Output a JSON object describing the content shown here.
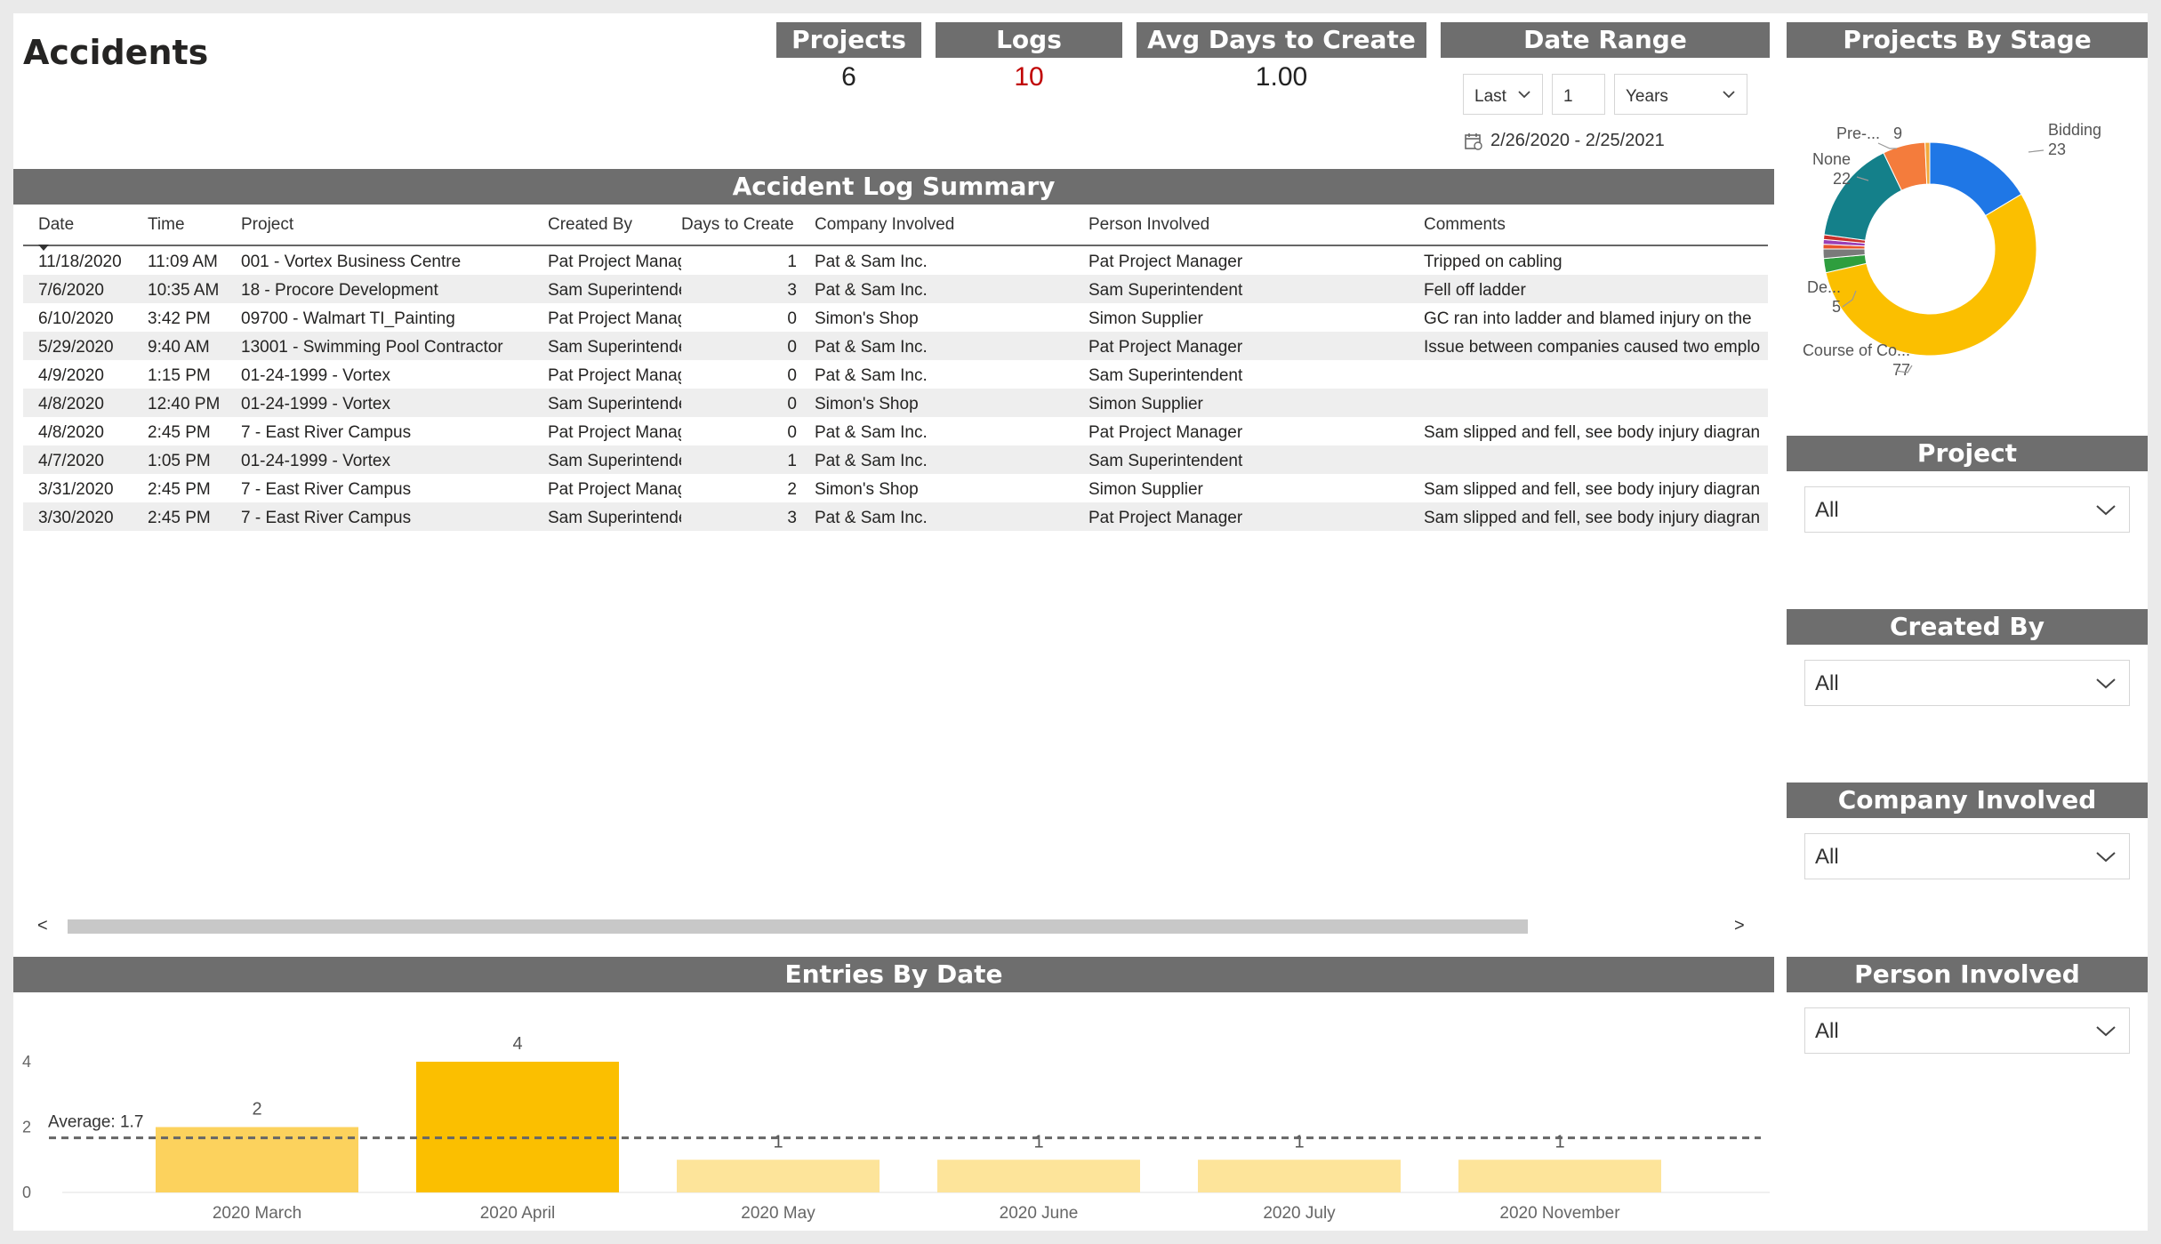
{
  "page": {
    "title": "Accidents"
  },
  "kpis": [
    {
      "label": "Projects",
      "value": "6"
    },
    {
      "label": "Logs",
      "value": "10"
    },
    {
      "label": "Avg Days to Create",
      "value": "1.00"
    }
  ],
  "colors": {
    "header_bg": "#6e6e6e",
    "logs_value": "#c00000",
    "bar_highlight": "#fbbf00",
    "bar_light": "#fcd25d",
    "bar_faded": "#fde49a"
  },
  "date_range": {
    "title": "Date Range",
    "mode": "Last",
    "count": "1",
    "unit": "Years",
    "range_text": "2/26/2020 - 2/25/2021"
  },
  "table": {
    "title": "Accident Log Summary",
    "columns": [
      "Date",
      "Time",
      "Project",
      "Created By",
      "Days to Create",
      "Company Involved",
      "Person Involved",
      "Comments"
    ],
    "rows": [
      [
        "11/18/2020",
        "11:09 AM",
        "001 - Vortex Business Centre",
        "Pat Project Manager",
        "1",
        "Pat & Sam Inc.",
        "Pat Project Manager",
        "Tripped on cabling"
      ],
      [
        "7/6/2020",
        "10:35 AM",
        "18 - Procore Development",
        "Sam Superintendent",
        "3",
        "Pat & Sam Inc.",
        "Sam Superintendent",
        "Fell off ladder"
      ],
      [
        "6/10/2020",
        "3:42 PM",
        "09700 - Walmart TI_Painting",
        "Pat Project Manager",
        "0",
        "Simon's Shop",
        "Simon Supplier",
        "GC ran into ladder and blamed injury on the"
      ],
      [
        "5/29/2020",
        "9:40 AM",
        "13001 - Swimming Pool Contractor",
        "Sam Superintendent",
        "0",
        "Pat & Sam Inc.",
        "Pat Project Manager",
        "Issue between companies caused two emplo"
      ],
      [
        "4/9/2020",
        "1:15 PM",
        "01-24-1999 - Vortex",
        "Pat Project Manager",
        "0",
        "Pat & Sam Inc.",
        "Sam Superintendent",
        ""
      ],
      [
        "4/8/2020",
        "12:40 PM",
        "01-24-1999 - Vortex",
        "Sam Superintendent",
        "0",
        "Simon's Shop",
        "Simon Supplier",
        ""
      ],
      [
        "4/8/2020",
        "2:45 PM",
        "7 - East River Campus",
        "Pat Project Manager",
        "0",
        "Pat & Sam Inc.",
        "Pat Project Manager",
        "Sam slipped and fell, see body injury diagran"
      ],
      [
        "4/7/2020",
        "1:05 PM",
        "01-24-1999 - Vortex",
        "Sam Superintendent",
        "1",
        "Pat & Sam Inc.",
        "Sam Superintendent",
        ""
      ],
      [
        "3/31/2020",
        "2:45 PM",
        "7 - East River Campus",
        "Pat Project Manager",
        "2",
        "Simon's Shop",
        "Simon Supplier",
        "Sam slipped and fell, see body injury diagran"
      ],
      [
        "3/30/2020",
        "2:45 PM",
        "7 - East River Campus",
        "Sam Superintendent",
        "3",
        "Pat & Sam Inc.",
        "Pat Project Manager",
        "Sam slipped and fell, see body injury diagran"
      ]
    ],
    "scroll_left": "<",
    "scroll_right": ">"
  },
  "donut": {
    "title": "Projects By Stage",
    "labels": [
      {
        "name": "Bidding",
        "value": "23"
      },
      {
        "name": "Pre-...",
        "value": "9"
      },
      {
        "name": "None",
        "value": "22"
      },
      {
        "name": "De...",
        "value": "5"
      },
      {
        "name": "Course of Co...",
        "value": "77"
      }
    ]
  },
  "slicers": [
    {
      "title": "Project",
      "value": "All"
    },
    {
      "title": "Created By",
      "value": "All"
    },
    {
      "title": "Company Involved",
      "value": "All"
    },
    {
      "title": "Person Involved",
      "value": "All"
    }
  ],
  "chart_data": [
    {
      "type": "pie",
      "title": "Projects By Stage",
      "slices": [
        {
          "name": "Bidding",
          "value": 23,
          "color": "#1f77e6"
        },
        {
          "name": "Course of Co...",
          "value": 77,
          "color": "#fbbf00"
        },
        {
          "name": "",
          "value": 3,
          "color": "#2e9e3e"
        },
        {
          "name": "",
          "value": 2,
          "color": "#7a7a7a"
        },
        {
          "name": "",
          "value": 1,
          "color": "#e8542b"
        },
        {
          "name": "",
          "value": 1,
          "color": "#9b3fb5"
        },
        {
          "name": "",
          "value": 1,
          "color": "#c9302c"
        },
        {
          "name": "None",
          "value": 22,
          "color": "#14808a"
        },
        {
          "name": "",
          "value": 9,
          "color": "#f47c3c"
        },
        {
          "name": "",
          "value": 1,
          "color": "#f2a93b"
        }
      ]
    },
    {
      "type": "bar",
      "title": "Entries By Date",
      "categories": [
        "2020 March",
        "2020 April",
        "2020 May",
        "2020 June",
        "2020 July",
        "2020 November"
      ],
      "values": [
        2,
        4,
        1,
        1,
        1,
        1
      ],
      "average_label": "Average: 1.7",
      "average": 1.67,
      "ylim": [
        0,
        4
      ],
      "yticks": [
        "0",
        "2",
        "4"
      ],
      "xlabel": "",
      "ylabel": ""
    }
  ]
}
